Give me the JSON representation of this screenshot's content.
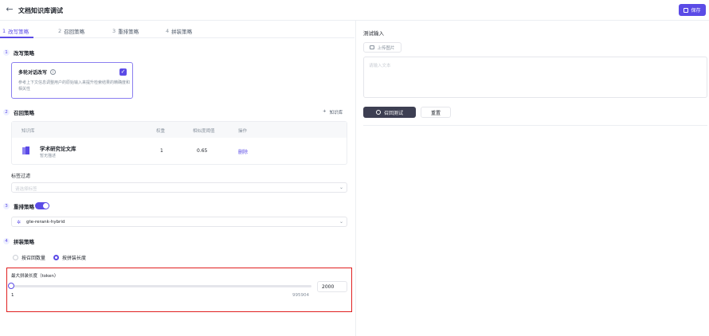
{
  "header": {
    "title": "文档知识库调试",
    "back_icon": "arrow-left-icon",
    "save_label": "保存",
    "save_icon": "save-icon",
    "accent": "#5b4be6"
  },
  "tabs": [
    {
      "num": "1",
      "label": "改写策略",
      "active": true
    },
    {
      "num": "2",
      "label": "召回策略",
      "active": false
    },
    {
      "num": "3",
      "label": "重排策略",
      "active": false
    },
    {
      "num": "4",
      "label": "拼装策略",
      "active": false
    }
  ],
  "rewrite": {
    "num": "1",
    "title": "改写策略",
    "card_title": "多轮对话改写",
    "card_desc": "参考上下文信息调整用户的原始输入来提升检索结果的精确度和相关性",
    "checked": true
  },
  "recall": {
    "num": "2",
    "title": "召回策略",
    "add_label": "知识库",
    "columns": [
      "知识库",
      "权重",
      "相似度阈值",
      "操作"
    ],
    "rows": [
      {
        "name": "学术研究论文库",
        "desc": "暂无描述",
        "weight": "1",
        "threshold": "0.65",
        "action": "删除"
      }
    ]
  },
  "filter": {
    "label": "标签过滤",
    "placeholder": "请选择标签"
  },
  "rerank": {
    "num": "3",
    "title": "重排策略",
    "enabled": true,
    "model": "gte-rerank-hybrid"
  },
  "assemble": {
    "num": "4",
    "title": "拼装策略",
    "options": [
      {
        "label": "按召回数量",
        "selected": false
      },
      {
        "label": "按拼装长度",
        "selected": true
      }
    ],
    "max_label": "最大拼装长度（token）",
    "slider_min": "1",
    "slider_max": "995904",
    "slider_value": 0,
    "input_value": "2000"
  },
  "test": {
    "label": "测试输入",
    "upload_label": "上传图片",
    "input_placeholder": "请输入文本",
    "recall_label": "召回测试",
    "reset_label": "重置"
  }
}
